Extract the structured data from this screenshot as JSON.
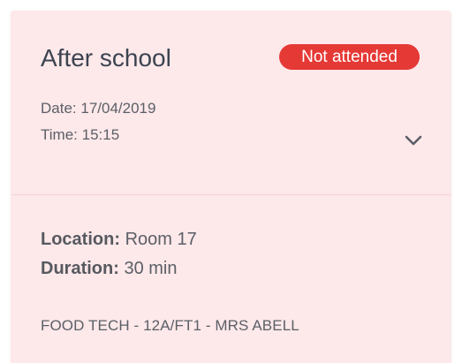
{
  "card": {
    "title": "After school",
    "status_badge": "Not attended",
    "date_label": "Date:",
    "date_value": "17/04/2019",
    "time_label": "Time:",
    "time_value": "15:15",
    "expand_icon": "chevron-down-icon"
  },
  "details": {
    "location_label": "Location:",
    "location_value": "Room 17",
    "duration_label": "Duration:",
    "duration_value": "30 min",
    "lesson_info": "FOOD TECH - 12A/FT1 - MRS ABELL"
  },
  "colors": {
    "card_background": "#fde8ea",
    "badge_background": "#e53935",
    "badge_text": "#ffffff",
    "title_text": "#3b4450",
    "body_text": "#5b5f66"
  }
}
